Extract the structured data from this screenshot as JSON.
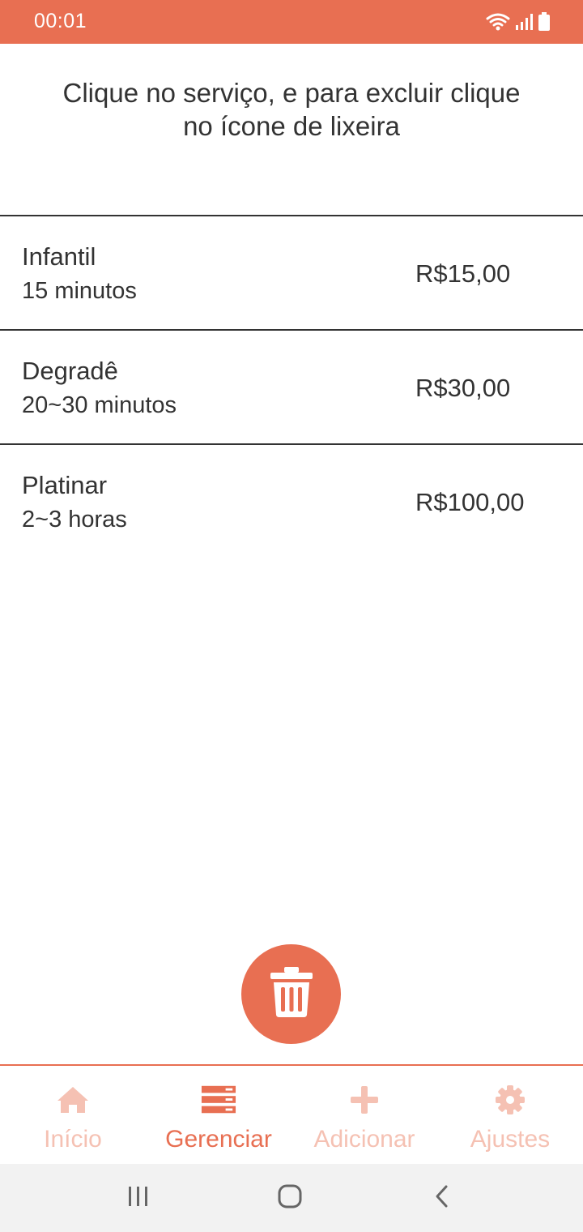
{
  "status_bar": {
    "time": "00:01",
    "color": "#E86F52",
    "icons": [
      "wifi-icon",
      "signal-icon",
      "battery-icon"
    ]
  },
  "instruction": {
    "line1": "Clique no serviço, e para excluir clique",
    "line2": "no ícone de lixeira"
  },
  "services": [
    {
      "name": "Infantil",
      "duration": "15 minutos",
      "price": "R$15,00"
    },
    {
      "name": "Degradê",
      "duration": "20~30 minutos",
      "price": "R$30,00"
    },
    {
      "name": "Platinar",
      "duration": "2~3 horas",
      "price": "R$100,00"
    }
  ],
  "trash_button": {
    "icon": "trash-icon",
    "color": "#E86F52"
  },
  "bottom_nav": {
    "active_color": "#E86F52",
    "inactive_color": "#F5C1B3",
    "items": [
      {
        "label": "Início",
        "icon": "home-icon",
        "active": false
      },
      {
        "label": "Gerenciar",
        "icon": "list-icon",
        "active": true
      },
      {
        "label": "Adicionar",
        "icon": "plus-icon",
        "active": false
      },
      {
        "label": "Ajustes",
        "icon": "gear-icon",
        "active": false
      }
    ]
  },
  "system_nav": {
    "buttons": [
      "recents-icon",
      "home-button-icon",
      "back-icon"
    ]
  }
}
